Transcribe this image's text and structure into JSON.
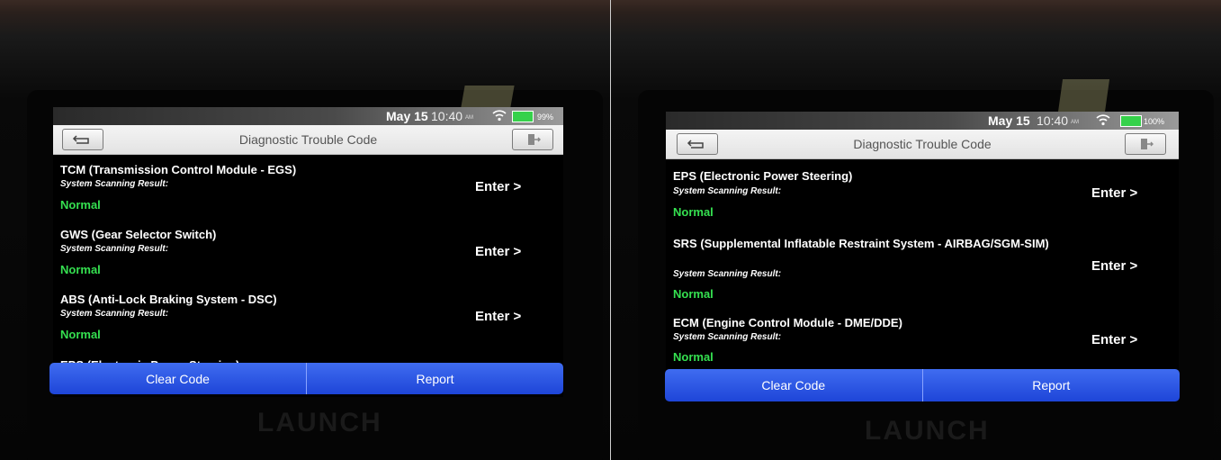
{
  "brand": "LAUNCH",
  "status_bar": {
    "date": "May 15",
    "time": "10:40",
    "ampm": "AM",
    "battery_left": "99%",
    "battery_right": "100%"
  },
  "header": {
    "title": "Diagnostic Trouble Code"
  },
  "labels": {
    "scan_result": "System Scanning Result:",
    "normal": "Normal",
    "enter": "Enter >"
  },
  "left_items": [
    {
      "name": "TCM (Transmission Control Module - EGS)"
    },
    {
      "name": "GWS (Gear Selector Switch)"
    },
    {
      "name": "ABS (Anti-Lock Braking System - DSC)"
    },
    {
      "name": "EPS (Electronic Power Steering)"
    }
  ],
  "right_items": [
    {
      "name": "EPS (Electronic Power Steering)"
    },
    {
      "name": "SRS (Supplemental Inflatable Restraint System - AIRBAG/SGM-SIM)"
    },
    {
      "name": "ECM (Engine Control Module - DME/DDE)"
    }
  ],
  "buttons": {
    "clear_code": "Clear Code",
    "report": "Report"
  },
  "colors": {
    "button_blue": "#2a52e0",
    "status_green": "#35e050"
  }
}
